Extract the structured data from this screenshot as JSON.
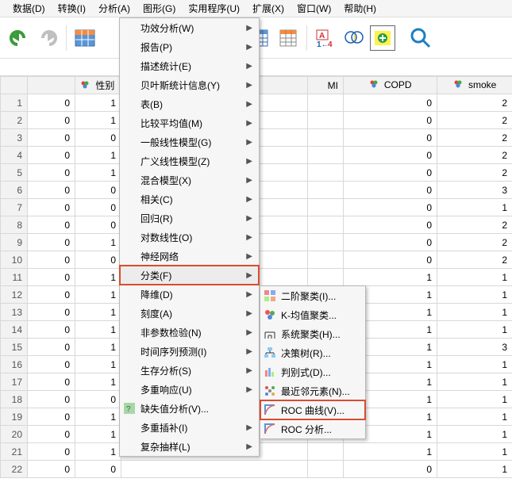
{
  "menubar": {
    "data": "数据(D)",
    "transform": "转换(I)",
    "analyze": "分析(A)",
    "graph": "图形(G)",
    "utilities": "实用程序(U)",
    "extend": "扩展(X)",
    "window": "窗口(W)",
    "help": "帮助(H)"
  },
  "headers": {
    "gender": "性别",
    "mi": "MI",
    "copd": "COPD",
    "smoke": "smoke"
  },
  "rows": [
    {
      "n": "1",
      "a": "0",
      "b": "1",
      "mi": "",
      "copd": "0",
      "smoke": "2"
    },
    {
      "n": "2",
      "a": "0",
      "b": "1",
      "mi": "",
      "copd": "0",
      "smoke": "2"
    },
    {
      "n": "3",
      "a": "0",
      "b": "0",
      "mi": "",
      "copd": "0",
      "smoke": "2"
    },
    {
      "n": "4",
      "a": "0",
      "b": "1",
      "mi": "",
      "copd": "0",
      "smoke": "2"
    },
    {
      "n": "5",
      "a": "0",
      "b": "1",
      "mi": "",
      "copd": "0",
      "smoke": "2"
    },
    {
      "n": "6",
      "a": "0",
      "b": "0",
      "mi": "",
      "copd": "0",
      "smoke": "3"
    },
    {
      "n": "7",
      "a": "0",
      "b": "0",
      "mi": "",
      "copd": "0",
      "smoke": "1"
    },
    {
      "n": "8",
      "a": "0",
      "b": "0",
      "mi": "",
      "copd": "0",
      "smoke": "2"
    },
    {
      "n": "9",
      "a": "0",
      "b": "1",
      "mi": "",
      "copd": "0",
      "smoke": "2"
    },
    {
      "n": "10",
      "a": "0",
      "b": "0",
      "mi": "",
      "copd": "0",
      "smoke": "2"
    },
    {
      "n": "11",
      "a": "0",
      "b": "1",
      "mi": "",
      "copd": "1",
      "smoke": "1"
    },
    {
      "n": "12",
      "a": "0",
      "b": "1",
      "mi": "",
      "copd": "1",
      "smoke": "1"
    },
    {
      "n": "13",
      "a": "0",
      "b": "1",
      "mi": "",
      "copd": "1",
      "smoke": "1"
    },
    {
      "n": "14",
      "a": "0",
      "b": "1",
      "mi": "",
      "copd": "1",
      "smoke": "1"
    },
    {
      "n": "15",
      "a": "0",
      "b": "1",
      "mi": "",
      "copd": "1",
      "smoke": "3"
    },
    {
      "n": "16",
      "a": "0",
      "b": "1",
      "mi": "",
      "copd": "1",
      "smoke": "1"
    },
    {
      "n": "17",
      "a": "0",
      "b": "1",
      "mi": "",
      "copd": "1",
      "smoke": "1"
    },
    {
      "n": "18",
      "a": "0",
      "b": "0",
      "mi": "",
      "copd": "1",
      "smoke": "1"
    },
    {
      "n": "19",
      "a": "0",
      "b": "1",
      "mi": "",
      "copd": "1",
      "smoke": "1"
    },
    {
      "n": "20",
      "a": "0",
      "b": "1",
      "mi": "",
      "copd": "1",
      "smoke": "1"
    },
    {
      "n": "21",
      "a": "0",
      "b": "1",
      "mi": "",
      "copd": "1",
      "smoke": "1"
    },
    {
      "n": "22",
      "a": "0",
      "b": "0",
      "mi": "",
      "copd": "0",
      "smoke": "1"
    }
  ],
  "analyze_menu": {
    "power": {
      "label": "功效分析(W)",
      "arrow": true
    },
    "report": {
      "label": "报告(P)",
      "arrow": true
    },
    "descriptive": {
      "label": "描述统计(E)",
      "arrow": true
    },
    "bayes": {
      "label": "贝叶斯统计信息(Y)",
      "arrow": true
    },
    "tables": {
      "label": "表(B)",
      "arrow": true
    },
    "compare": {
      "label": "比较平均值(M)",
      "arrow": true
    },
    "glm": {
      "label": "一般线性模型(G)",
      "arrow": true
    },
    "gzlm": {
      "label": "广义线性模型(Z)",
      "arrow": true
    },
    "mixed": {
      "label": "混合模型(X)",
      "arrow": true
    },
    "corr": {
      "label": "相关(C)",
      "arrow": true
    },
    "reg": {
      "label": "回归(R)",
      "arrow": true
    },
    "loglin": {
      "label": "对数线性(O)",
      "arrow": true
    },
    "neural": {
      "label": "神经网络",
      "arrow": true
    },
    "classify": {
      "label": "分类(F)",
      "arrow": true
    },
    "dimred": {
      "label": "降维(D)",
      "arrow": true
    },
    "scale": {
      "label": "刻度(A)",
      "arrow": true
    },
    "nonpar": {
      "label": "非参数检验(N)",
      "arrow": true
    },
    "tsf": {
      "label": "时间序列预测(I)",
      "arrow": true
    },
    "surv": {
      "label": "生存分析(S)",
      "arrow": true
    },
    "multi": {
      "label": "多重响应(U)",
      "arrow": true
    },
    "missing": {
      "label": "缺失值分析(V)...",
      "arrow": false
    },
    "mimp": {
      "label": "多重插补(I)",
      "arrow": true
    },
    "complex": {
      "label": "复杂抽样(L)",
      "arrow": true
    }
  },
  "classify_submenu": {
    "twostep": "二阶聚类(I)...",
    "kmeans": "K-均值聚类...",
    "hier": "系统聚类(H)...",
    "tree": "决策树(R)...",
    "discrim": "判别式(D)...",
    "nn": "最近邻元素(N)...",
    "roc": "ROC 曲线(V)...",
    "rocanal": "ROC 分析..."
  }
}
